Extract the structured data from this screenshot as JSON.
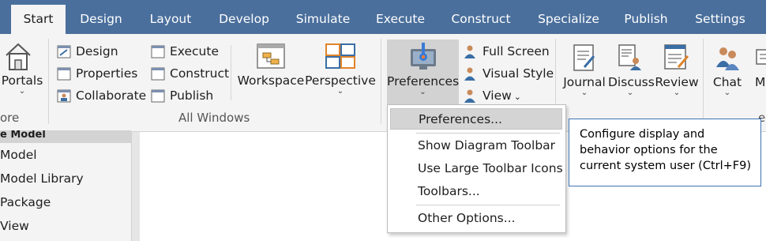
{
  "tabs": [
    {
      "label": "Start",
      "active": true
    },
    {
      "label": "Design"
    },
    {
      "label": "Layout"
    },
    {
      "label": "Develop"
    },
    {
      "label": "Simulate"
    },
    {
      "label": "Execute"
    },
    {
      "label": "Construct"
    },
    {
      "label": "Specialize"
    },
    {
      "label": "Publish"
    },
    {
      "label": "Settings"
    }
  ],
  "ribbon": {
    "portals": {
      "label": "Portals",
      "group_label": "ore"
    },
    "all_windows": {
      "group_label": "All Windows",
      "col1": [
        {
          "label": "Design",
          "icon": "design-window-icon"
        },
        {
          "label": "Properties",
          "icon": "properties-window-icon"
        },
        {
          "label": "Collaborate",
          "icon": "collaborate-window-icon"
        }
      ],
      "col2": [
        {
          "label": "Execute",
          "icon": "execute-window-icon"
        },
        {
          "label": "Construct",
          "icon": "construct-window-icon"
        },
        {
          "label": "Publish",
          "icon": "publish-window-icon"
        }
      ],
      "workspace": "Workspace",
      "perspective": "Perspective"
    },
    "preferences": {
      "label": "Preferences"
    },
    "view_small": [
      {
        "label": "Full Screen",
        "icon": "full-screen-icon"
      },
      {
        "label": "Visual Style",
        "icon": "visual-style-icon"
      },
      {
        "label": "View",
        "icon": "view-icon"
      }
    ],
    "journal": "Journal",
    "discuss": "Discuss",
    "review": "Review",
    "chat": "Chat",
    "more_partial": "M",
    "right_group_partial": "e"
  },
  "browser": {
    "header": "e Model",
    "items": [
      "Model",
      "Model Library",
      "Package",
      "View"
    ]
  },
  "menu": {
    "items": [
      {
        "label": "Preferences...",
        "highlighted": true
      },
      {
        "label": "Show Diagram Toolbar"
      },
      {
        "label": "Use Large Toolbar Icons"
      },
      {
        "label": "Toolbars..."
      },
      {
        "label": "Other Options..."
      }
    ]
  },
  "tooltip": {
    "text": "Configure display and behavior options for the current system user (Ctrl+F9)"
  },
  "colors": {
    "tab_bar": "#4a6f9c",
    "ribbon": "#f4f4f4",
    "tooltip_border": "#3e74b3",
    "menu_highlight": "#d4d4d4"
  }
}
